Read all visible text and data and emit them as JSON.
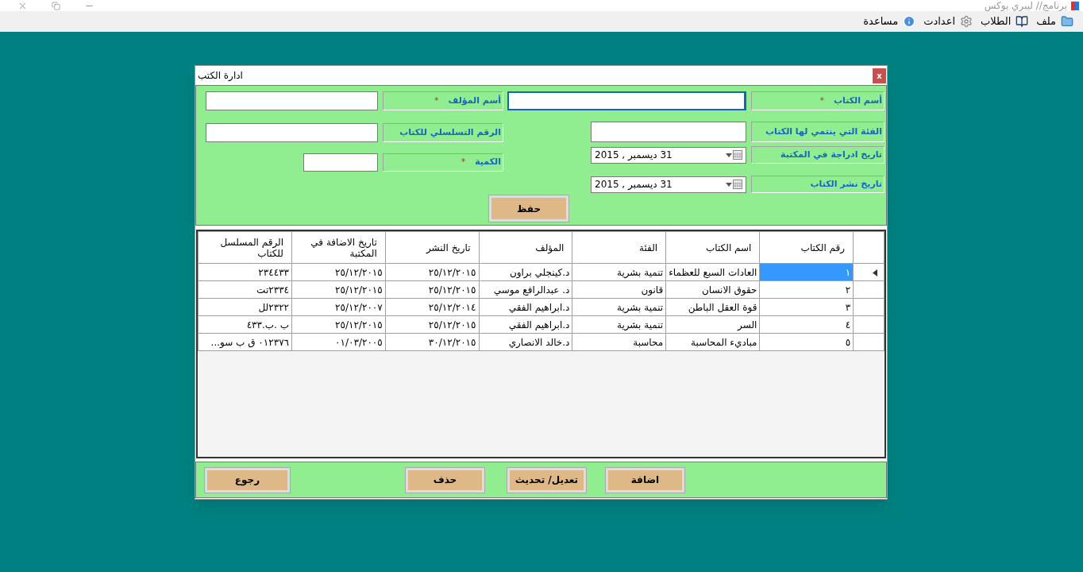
{
  "app": {
    "title": "برنامج// ليبري بوكس",
    "menu": [
      {
        "label": "ملف"
      },
      {
        "label": "الطلاب"
      },
      {
        "label": "اعدادت"
      },
      {
        "label": "مساعدة"
      }
    ]
  },
  "dialog": {
    "title": "ادارة الكتب",
    "close": "x",
    "form": {
      "right_fields": [
        {
          "label": "أسم الكتاب",
          "required_mark": "*",
          "kind": "text",
          "focused": true
        },
        {
          "label": "الفئة التي ينتمي لها الكتاب",
          "kind": "text",
          "focused": false
        },
        {
          "label": "تاريخ ادراجة في المكتبة",
          "kind": "date",
          "value": "31  ديسمبر , 2015"
        },
        {
          "label": "تاريخ نشر الكتاب",
          "kind": "date",
          "value": "31  ديسمبر , 2015"
        }
      ],
      "left_fields": [
        {
          "label": "أسم المؤلف",
          "required_mark": "*",
          "kind": "text",
          "focused": false
        },
        {
          "label": "الرقم التسلسلي للكتاب",
          "kind": "text",
          "focused": false
        },
        {
          "label": "الكمية",
          "required_mark": "*",
          "kind": "text",
          "focused": false
        }
      ],
      "save_button": "حفظ"
    },
    "table": {
      "columns": [
        "رقم الكتاب",
        "اسم الكتاب",
        "الفئة",
        "المؤلف",
        "تاريخ النشر",
        "تاريخ الاضافة في المكتبة",
        "الرقم المسلسل للكتاب"
      ],
      "rows": [
        {
          "selected": true,
          "cells": [
            "١",
            "العادات السبع للعظماء",
            "تنمية بشرية",
            "د.كينجلي براون",
            "٢٥/١٢/٢٠١٥",
            "٢٥/١٢/٢٠١٥",
            "٢٣٤٤٣٣"
          ]
        },
        {
          "selected": false,
          "cells": [
            "٢",
            "حقوق الانسان",
            "قانون",
            "د. عبدالرافع موسي",
            "٢٥/١٢/٢٠١٥",
            "٢٥/١٢/٢٠١٥",
            "٢٣٣٤تت"
          ]
        },
        {
          "selected": false,
          "cells": [
            "٣",
            "قوة العقل الباطن",
            "تنمية بشرية",
            "د.ابراهيم الفقي",
            "٢٥/١٢/٢٠١٤",
            "٢٥/١٢/٢٠٠٧",
            "٢٣٢٢لل"
          ]
        },
        {
          "selected": false,
          "cells": [
            "٤",
            "السر",
            "تنمية بشرية",
            "د.ابراهيم الفقي",
            "٢٥/١٢/٢٠١٥",
            "٢٥/١٢/٢٠١٥",
            "ب .ب.٤٣٣"
          ]
        },
        {
          "selected": false,
          "cells": [
            "٥",
            "مباديء المحاسبة",
            "محاسبة",
            "د.خالد الانصاري",
            "٣٠/١٢/٢٠١٥",
            "٠١/٠٣/٢٠٠٥",
            "٠١٢٣٧٦ ق ب سو..."
          ]
        }
      ]
    },
    "buttons": [
      "اضافة",
      "تعديل/ تحديث",
      "حذف",
      "رجوع"
    ]
  }
}
